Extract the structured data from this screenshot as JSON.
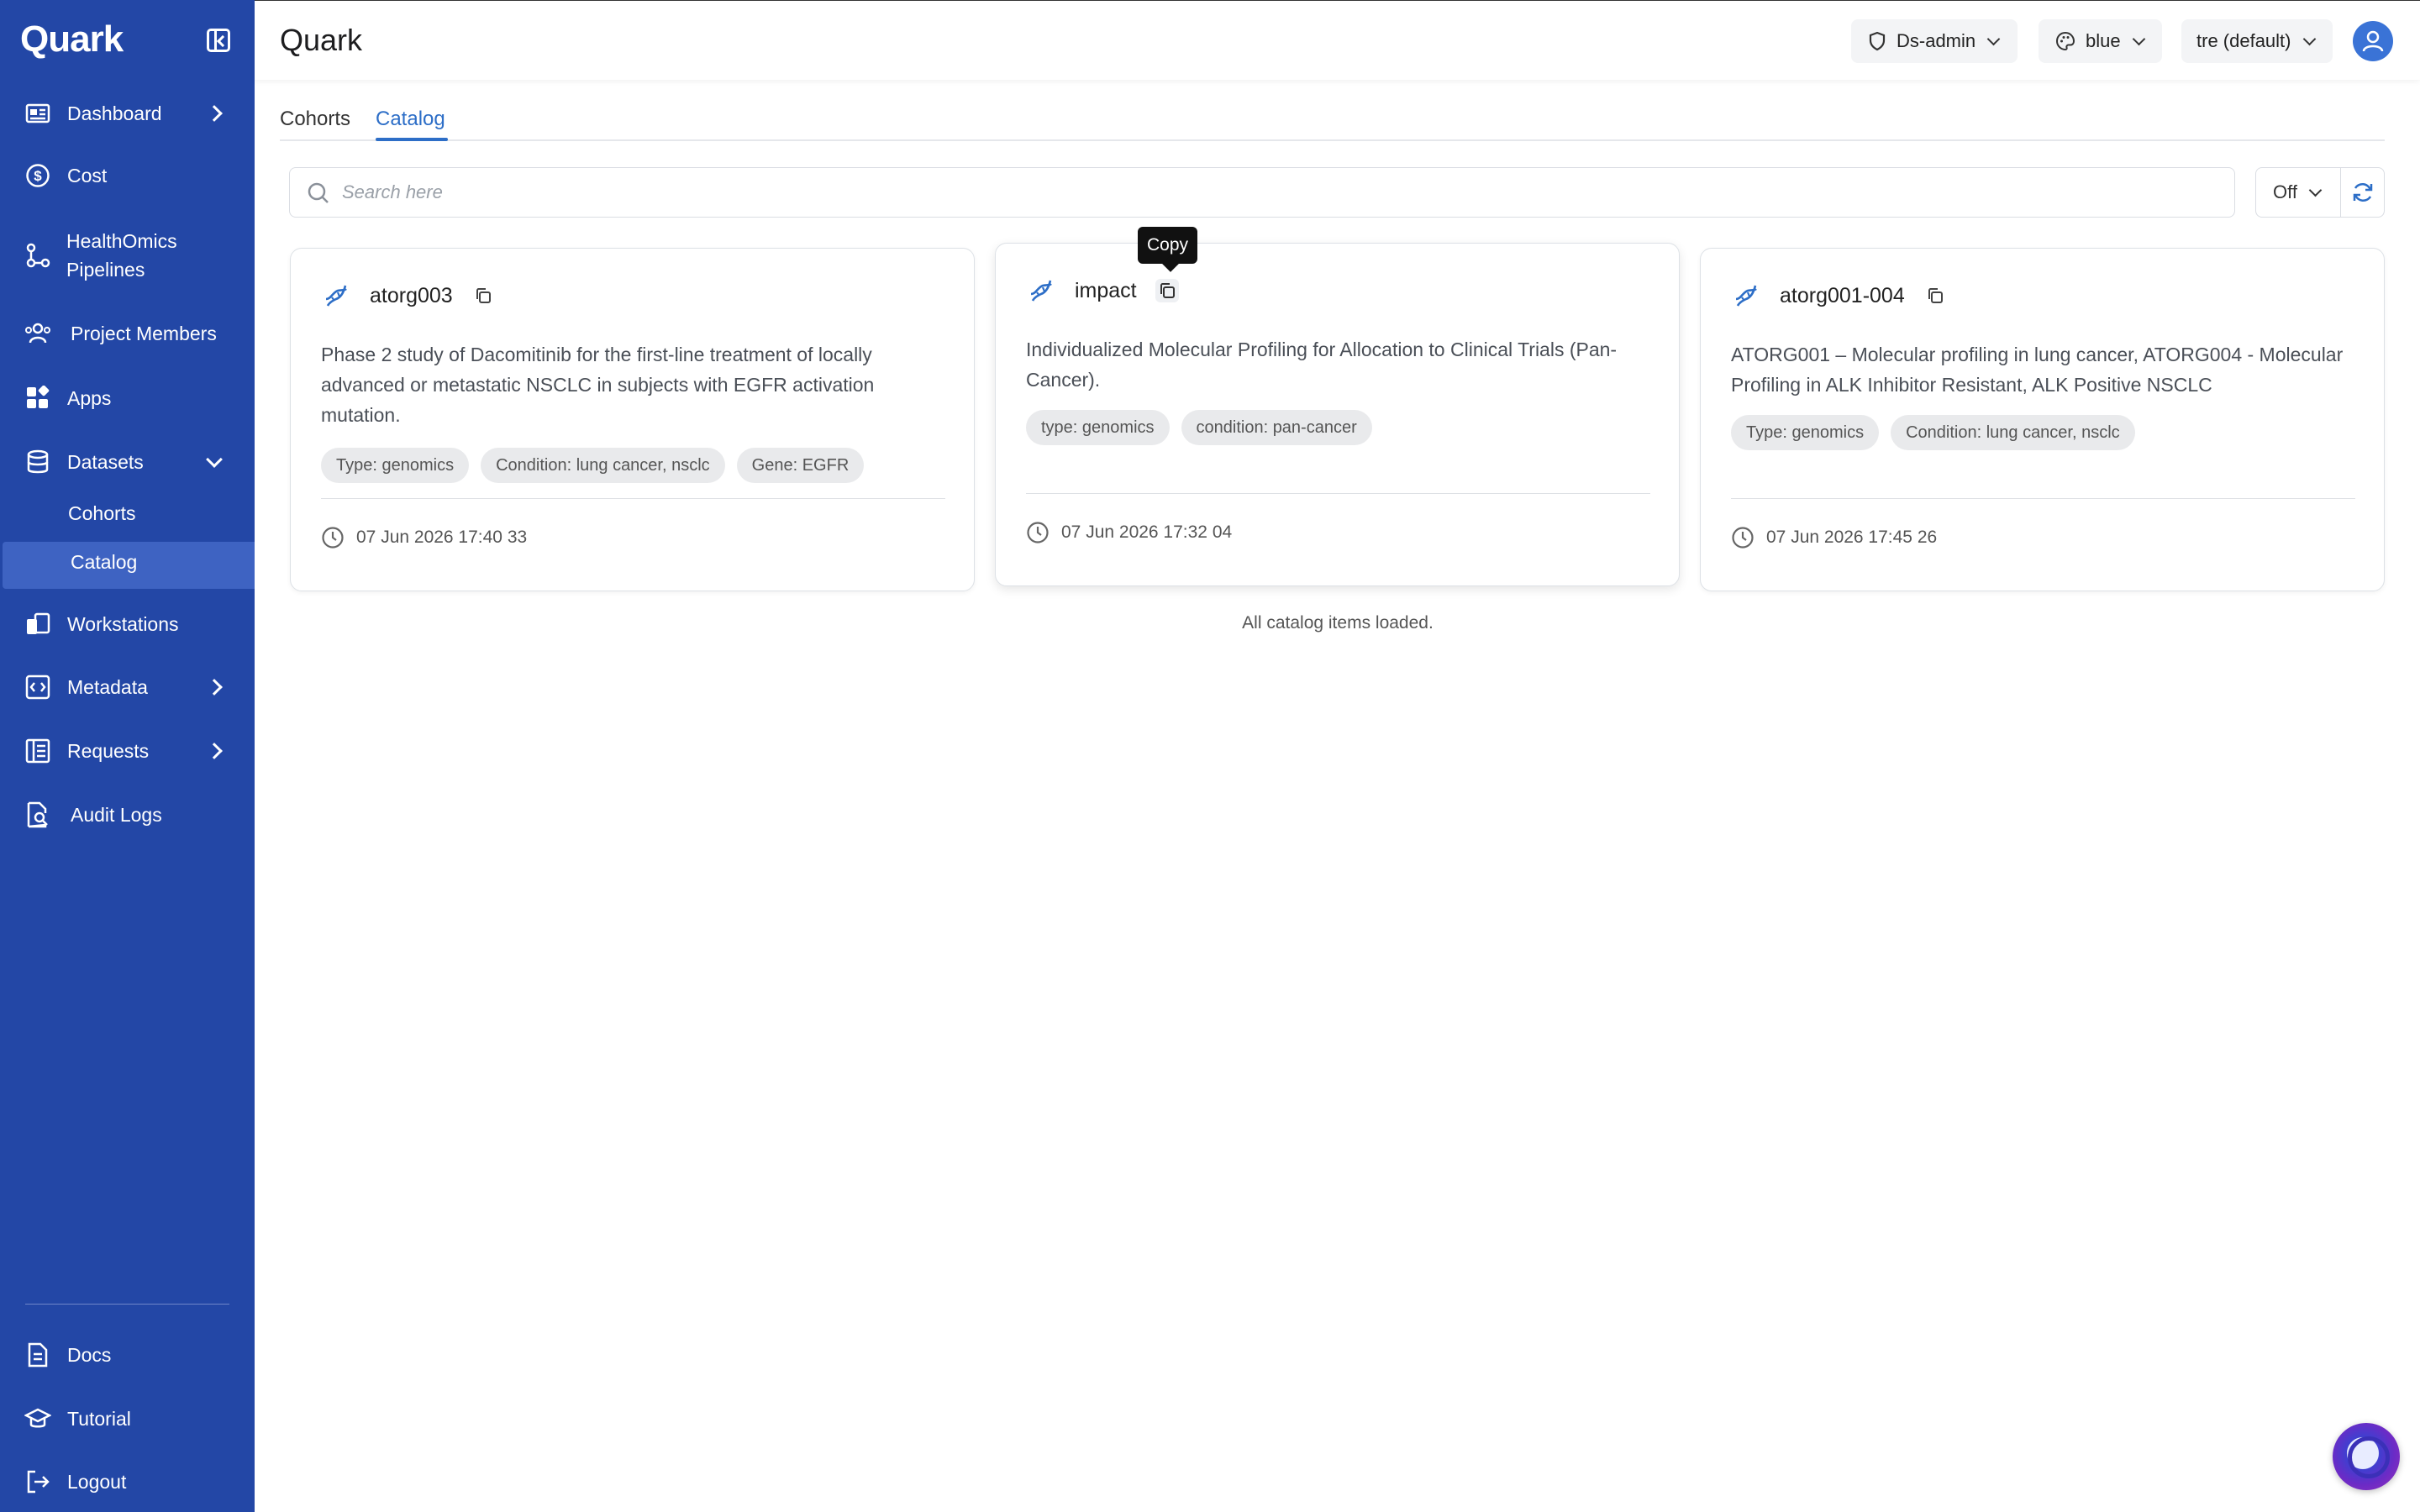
{
  "app": {
    "brand": "Quark",
    "title": "Quark"
  },
  "header": {
    "role_selector": "Ds-admin",
    "theme_selector": "blue",
    "workspace_selector": "tre (default)"
  },
  "sidebar": {
    "items": [
      {
        "label": "Dashboard",
        "icon": "dashboard-icon"
      },
      {
        "label": "Cost",
        "icon": "dollar-circle-icon"
      },
      {
        "label": "HealthOmics Pipelines",
        "line1": "HealthOmics",
        "line2": "Pipelines",
        "icon": "pipeline-icon"
      },
      {
        "label": "Project Members",
        "icon": "users-icon"
      },
      {
        "label": "Apps",
        "icon": "apps-icon"
      },
      {
        "label": "Datasets",
        "icon": "database-icon"
      },
      {
        "label": "Workstations",
        "icon": "workstation-icon"
      },
      {
        "label": "Metadata",
        "icon": "code-icon"
      },
      {
        "label": "Requests",
        "icon": "list-icon"
      },
      {
        "label": "Audit Logs",
        "icon": "file-search-icon"
      }
    ],
    "subitems": [
      {
        "label": "Cohorts"
      },
      {
        "label": "Catalog"
      }
    ],
    "bottom": [
      {
        "label": "Docs",
        "icon": "document-icon"
      },
      {
        "label": "Tutorial",
        "icon": "graduation-cap-icon"
      },
      {
        "label": "Logout",
        "icon": "logout-icon"
      }
    ]
  },
  "tabs": [
    {
      "label": "Cohorts"
    },
    {
      "label": "Catalog"
    }
  ],
  "search": {
    "placeholder": "Search here",
    "value": ""
  },
  "filter": {
    "selected": "Off"
  },
  "tooltip": {
    "text": "Copy"
  },
  "cards": [
    {
      "title": "atorg003",
      "description": "Phase 2 study of Dacomitinib for the first-line treatment of locally advanced or metastatic NSCLC in subjects with EGFR activation mutation.",
      "tags": [
        "Type: genomics",
        "Condition: lung cancer, nsclc",
        "Gene: EGFR"
      ],
      "date": "07 Jun 2026 17:40 33"
    },
    {
      "title": "impact",
      "description": "Individualized Molecular Profiling for Allocation to Clinical Trials (Pan-Cancer).",
      "tags": [
        "type: genomics",
        "condition: pan-cancer"
      ],
      "date": "07 Jun 2026 17:32 04"
    },
    {
      "title": "atorg001-004",
      "description": "ATORG001 – Molecular profiling in lung cancer, ATORG004 - Molecular Profiling in ALK Inhibitor Resistant, ALK Positive NSCLC",
      "tags": [
        "Type: genomics",
        "Condition: lung cancer, nsclc"
      ],
      "date": "07 Jun 2026 17:45 26"
    }
  ],
  "status": "All catalog items loaded.",
  "colors": {
    "sidebar": "#2347a6",
    "accent": "#2d6ec7",
    "active_subitem": "#3e63c2"
  }
}
